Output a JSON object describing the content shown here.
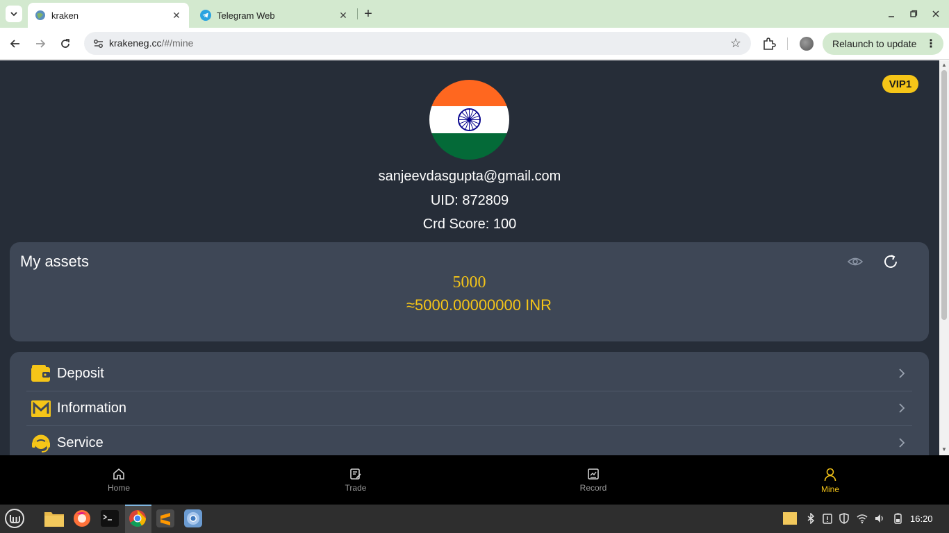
{
  "browser": {
    "tabs": [
      {
        "title": "kraken",
        "active": true
      },
      {
        "title": "Telegram Web",
        "active": false
      }
    ],
    "url_host": "krakeneg.cc",
    "url_path": "/#/mine",
    "relaunch_label": "Relaunch to update"
  },
  "profile": {
    "vip_badge": "VIP1",
    "email": "sanjeevdasgupta@gmail.com",
    "uid": "UID: 872809",
    "credit_score": "Crd Score: 100"
  },
  "assets": {
    "title": "My assets",
    "amount": "5000",
    "converted": "≈5000.00000000 INR"
  },
  "menu": {
    "items": [
      {
        "label": "Deposit",
        "icon": "wallet-icon"
      },
      {
        "label": "Information",
        "icon": "mail-icon"
      },
      {
        "label": "Service",
        "icon": "headset-icon"
      }
    ]
  },
  "bottom_nav": {
    "items": [
      {
        "label": "Home",
        "icon": "home-icon"
      },
      {
        "label": "Trade",
        "icon": "trade-icon"
      },
      {
        "label": "Record",
        "icon": "record-icon"
      },
      {
        "label": "Mine",
        "icon": "user-icon",
        "active": true
      }
    ]
  },
  "taskbar": {
    "clock": "16:20"
  },
  "colors": {
    "accent": "#f5c518",
    "page_bg": "#262d38",
    "card_bg": "#3e4756"
  }
}
